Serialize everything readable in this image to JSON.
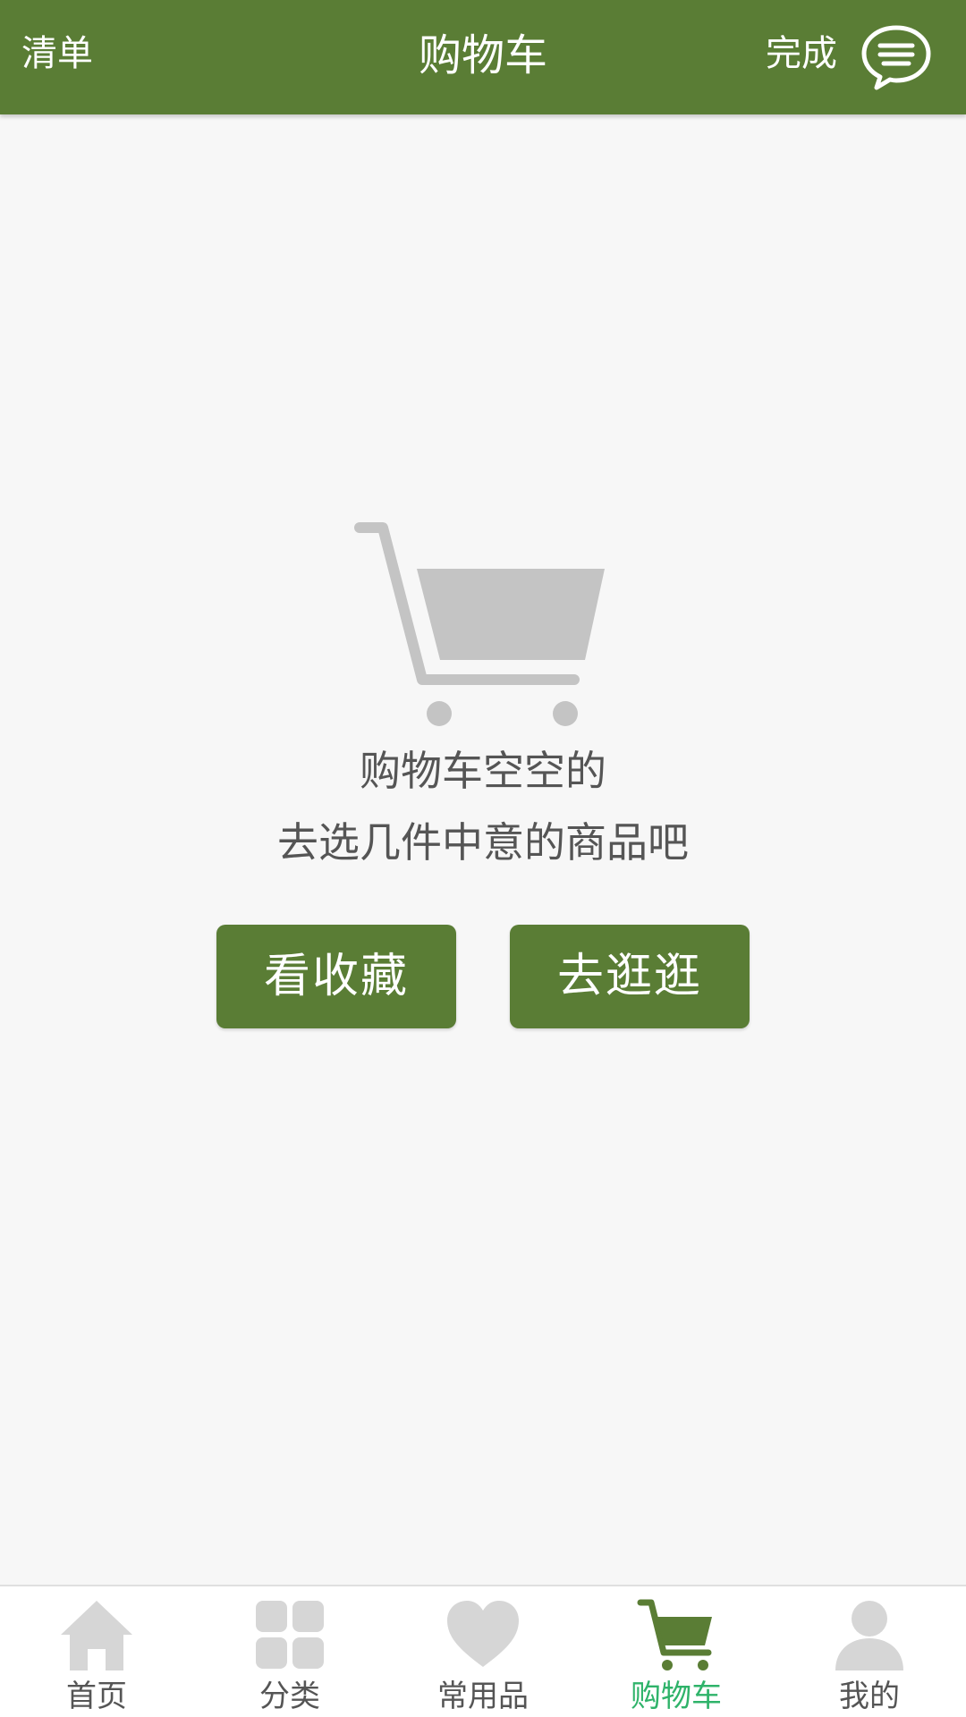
{
  "header": {
    "left_label": "清单",
    "title": "购物车",
    "done_label": "完成",
    "message_icon": "chat-bubble-icon"
  },
  "empty_state": {
    "icon": "shopping-cart-icon",
    "line1": "购物车空空的",
    "line2": "去选几件中意的商品吧",
    "buttons": {
      "favorites": "看收藏",
      "browse": "去逛逛"
    }
  },
  "tabbar": {
    "items": [
      {
        "label": "首页",
        "icon": "home-icon"
      },
      {
        "label": "分类",
        "icon": "category-grid-icon"
      },
      {
        "label": "常用品",
        "icon": "heart-icon"
      },
      {
        "label": "购物车",
        "icon": "cart-icon",
        "active": true
      },
      {
        "label": "我的",
        "icon": "user-icon"
      }
    ]
  },
  "colors": {
    "brand": "#5a7d35",
    "active_tab": "#2fb36a",
    "inactive_icon": "#d6d6d6",
    "background": "#f7f7f7"
  }
}
